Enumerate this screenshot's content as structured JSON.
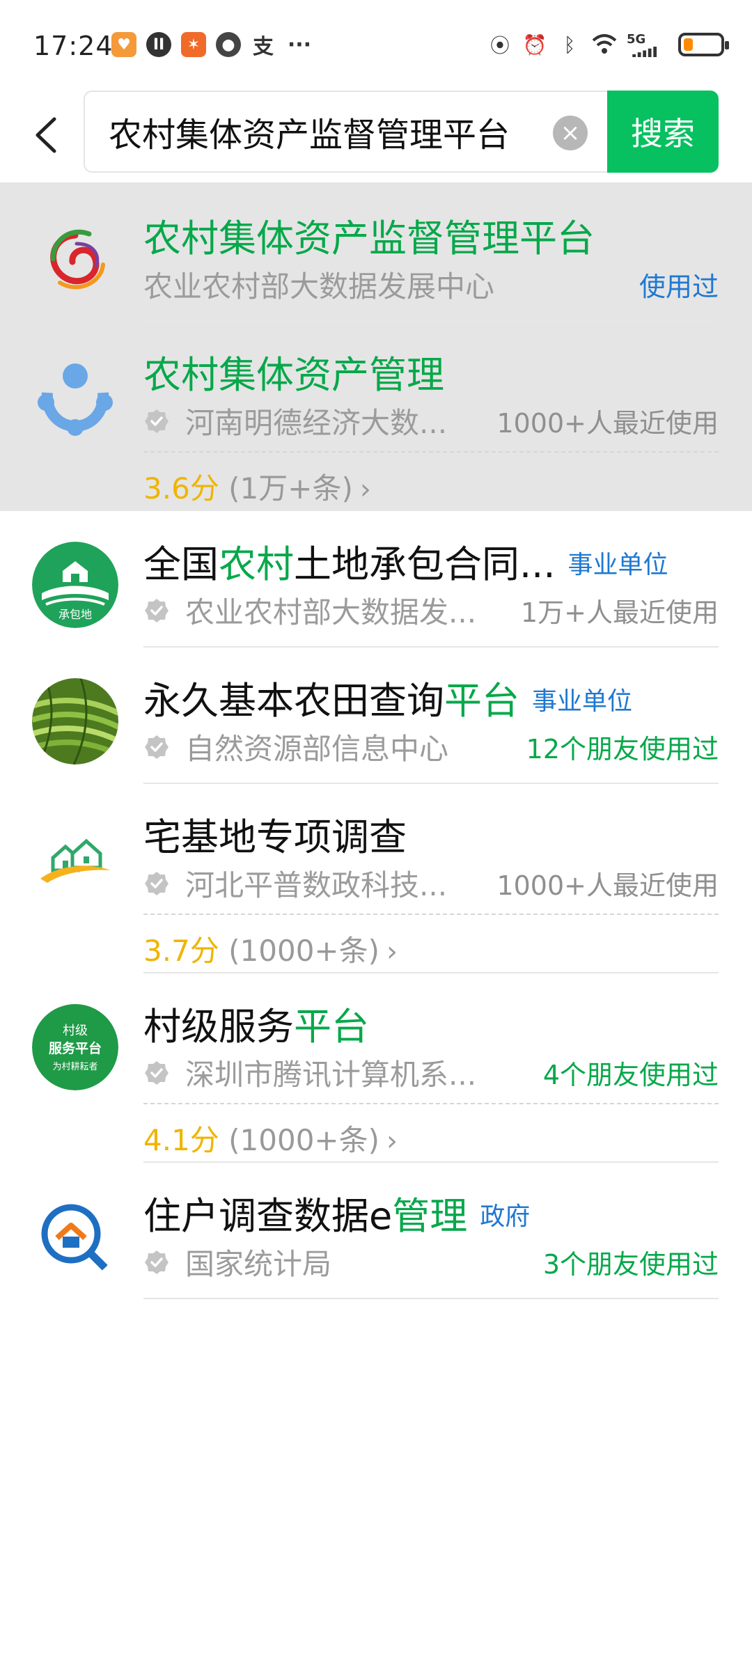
{
  "status_bar": {
    "time": "17:24",
    "notif_icons": [
      "app-badge-icon",
      "podcast-icon",
      "gamepad-icon",
      "fruit-icon",
      "alipay-icon"
    ],
    "more": "···",
    "network": "5G",
    "battery_level_percent": 25,
    "battery_color": "#ff8a00"
  },
  "search": {
    "query": "农村集体资产监督管理平台",
    "button_label": "搜索",
    "accent_color": "#07c160"
  },
  "results": [
    {
      "title_parts": [
        {
          "t": "农村集体资产监督管理平台",
          "g": true
        }
      ],
      "subtitle": "农业农村部大数据发展中心",
      "verified": false,
      "right_text": "使用过",
      "right_style": "blue",
      "logo": "swirl-logo-icon",
      "highlighted": true
    },
    {
      "title_parts": [
        {
          "t": "农村集体资产管理",
          "g": true
        }
      ],
      "subtitle": "河南明德经济大数...",
      "verified": true,
      "right_text": "1000+人最近使用",
      "right_style": "gray",
      "score": "3.6分",
      "count": "(1万+条)",
      "logo": "people-circle-logo-icon",
      "highlighted": true
    },
    {
      "title_parts": [
        {
          "t": "全国",
          "g": false
        },
        {
          "t": "农村",
          "g": true
        },
        {
          "t": "土地承包合同...",
          "g": false
        }
      ],
      "tag": "事业单位",
      "subtitle": "农业农村部大数据发...",
      "verified": true,
      "right_text": "1万+人最近使用",
      "right_style": "gray",
      "logo": "land-contract-logo-icon",
      "logo_text": "承包地"
    },
    {
      "title_parts": [
        {
          "t": "永久基本农田查询",
          "g": false
        },
        {
          "t": "平台",
          "g": true
        }
      ],
      "tag": "事业单位",
      "subtitle": "自然资源部信息中心",
      "verified": true,
      "right_text": "12个朋友使用过",
      "right_style": "green",
      "logo": "terraced-field-logo-icon"
    },
    {
      "title_parts": [
        {
          "t": "宅基地专项调查",
          "g": false
        }
      ],
      "subtitle": "河北平普数政科技...",
      "verified": true,
      "right_text": "1000+人最近使用",
      "right_style": "gray",
      "score": "3.7分",
      "count": "(1000+条)",
      "logo": "houses-logo-icon"
    },
    {
      "title_parts": [
        {
          "t": "村级服务",
          "g": false
        },
        {
          "t": "平台",
          "g": true
        }
      ],
      "subtitle": "深圳市腾讯计算机系...",
      "verified": true,
      "right_text": "4个朋友使用过",
      "right_style": "green",
      "score": "4.1分",
      "count": "(1000+条)",
      "logo": "village-service-logo-icon",
      "logo_lines": [
        "村级",
        "服务平台",
        "为村耕耘者"
      ]
    },
    {
      "title_parts": [
        {
          "t": "住户调查数据e",
          "g": false
        },
        {
          "t": "管理",
          "g": true
        }
      ],
      "tag": "政府",
      "subtitle": "国家统计局",
      "verified": true,
      "right_text": "3个朋友使用过",
      "right_style": "green",
      "logo": "household-survey-logo-icon"
    }
  ]
}
